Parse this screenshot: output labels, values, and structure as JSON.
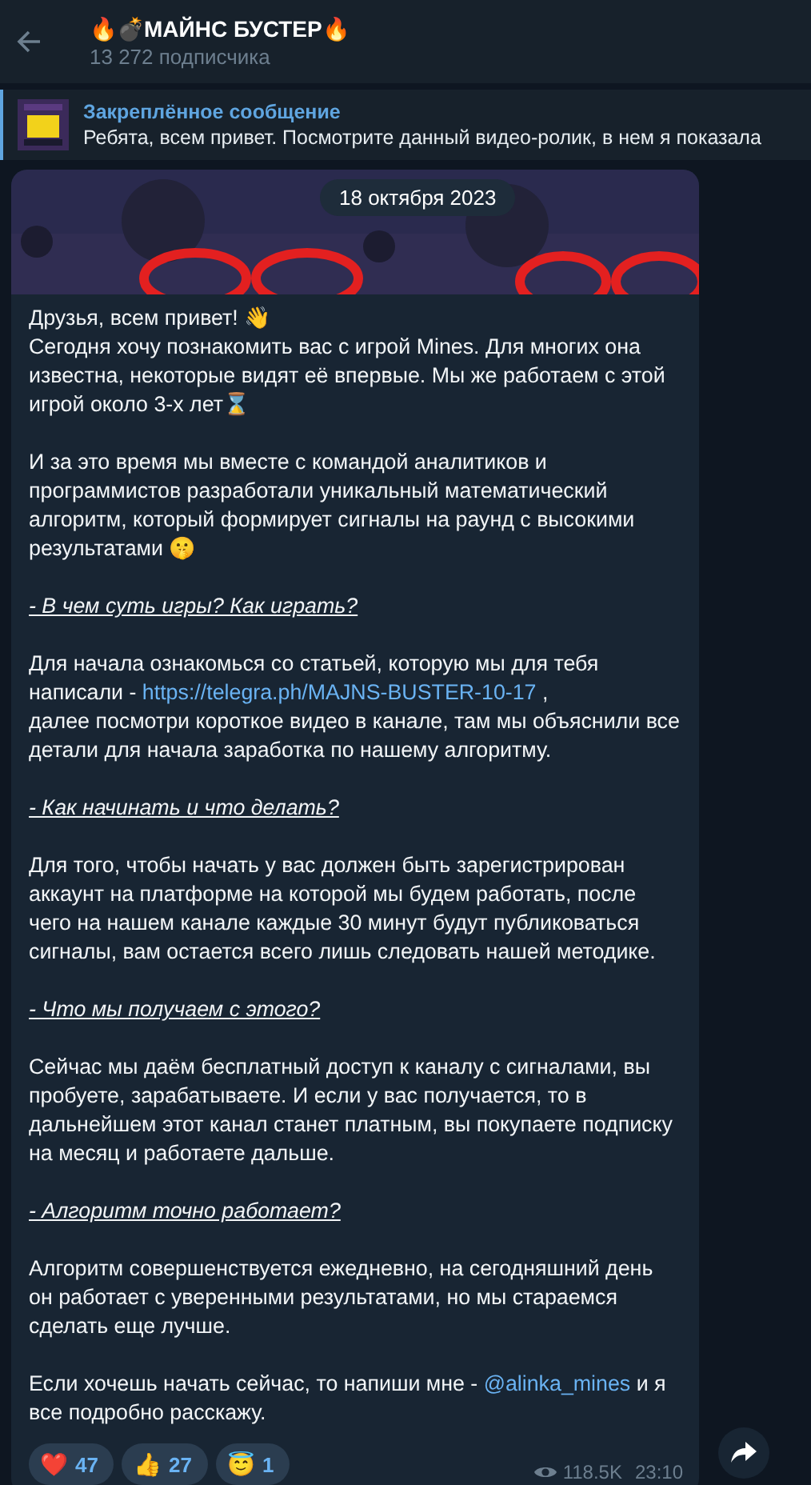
{
  "header": {
    "title": "🔥💣МАЙНС БУСТЕР🔥",
    "subtitle": "13 272 подписчика"
  },
  "pinned": {
    "title": "Закреплённое сообщение",
    "text": "Ребята, всем привет. Посмотрите данный видео-ролик, в нем я показала"
  },
  "date_badge": "18 октября 2023",
  "message": {
    "blocks": [
      {
        "kind": "paragraph",
        "parts": [
          {
            "text": "Друзья, всем привет! 👋"
          }
        ]
      },
      {
        "kind": "paragraph",
        "parts": [
          {
            "text": "Сегодня хочу познакомить вас с игрой Mines. Для многих она известна, некоторые видят её впервые. Мы же работаем с этой игрой около 3-х лет⌛"
          }
        ]
      },
      {
        "kind": "gap"
      },
      {
        "kind": "paragraph",
        "parts": [
          {
            "text": "И за это время мы вместе с командой аналитиков и программистов разработали уникальный математический алгоритм, который формирует сигналы на раунд с высокими результатами 🤫"
          }
        ]
      },
      {
        "kind": "gap"
      },
      {
        "kind": "heading",
        "parts": [
          {
            "text": "- В чем суть игры? Как играть?"
          }
        ]
      },
      {
        "kind": "gap"
      },
      {
        "kind": "paragraph",
        "parts": [
          {
            "text": "Для начала ознакомься со статьей, которую мы для тебя написали - "
          },
          {
            "text": "https://telegra.ph/MAJNS-BUSTER-10-17",
            "kind": "link"
          },
          {
            "text": " ,"
          }
        ]
      },
      {
        "kind": "paragraph",
        "parts": [
          {
            "text": "далее посмотри короткое видео в канале, там мы объяснили все детали для начала заработка по нашему алгоритму."
          }
        ]
      },
      {
        "kind": "gap"
      },
      {
        "kind": "heading",
        "parts": [
          {
            "text": "- Как начинать и что делать?"
          }
        ]
      },
      {
        "kind": "gap"
      },
      {
        "kind": "paragraph",
        "parts": [
          {
            "text": "Для того, чтобы начать у вас должен быть зарегистрирован аккаунт на платформе на которой мы будем работать, после чего на нашем канале каждые 30 минут будут публиковаться сигналы, вам остается всего лишь следовать нашей методике."
          }
        ]
      },
      {
        "kind": "gap"
      },
      {
        "kind": "heading",
        "parts": [
          {
            "text": "- Что мы получаем с этого?"
          }
        ]
      },
      {
        "kind": "gap"
      },
      {
        "kind": "paragraph",
        "parts": [
          {
            "text": "Сейчас мы даём бесплатный доступ к каналу с сигналами, вы пробуете, зарабатываете. И если у вас получается, то в дальнейшем этот канал станет платным, вы покупаете подписку на месяц и работаете дальше."
          }
        ]
      },
      {
        "kind": "gap"
      },
      {
        "kind": "heading",
        "parts": [
          {
            "text": "- Алгоритм точно работает?"
          }
        ]
      },
      {
        "kind": "gap"
      },
      {
        "kind": "paragraph",
        "parts": [
          {
            "text": "Алгоритм совершенствуется ежедневно, на сегодняшний день он работает с уверенными результатами, но мы стараемся сделать еще лучше."
          }
        ]
      },
      {
        "kind": "gap"
      },
      {
        "kind": "paragraph",
        "parts": [
          {
            "text": "Если хочешь начать сейчас, то напиши мне - "
          },
          {
            "text": "@alinka_mines",
            "kind": "link"
          },
          {
            "text": " и я все подробно расскажу."
          }
        ]
      }
    ],
    "reactions": [
      {
        "emoji": "❤️",
        "count": "47"
      },
      {
        "emoji": "👍",
        "count": "27"
      },
      {
        "emoji": "😇",
        "count": "1"
      }
    ],
    "views": "118.5K",
    "time": "23:10"
  }
}
